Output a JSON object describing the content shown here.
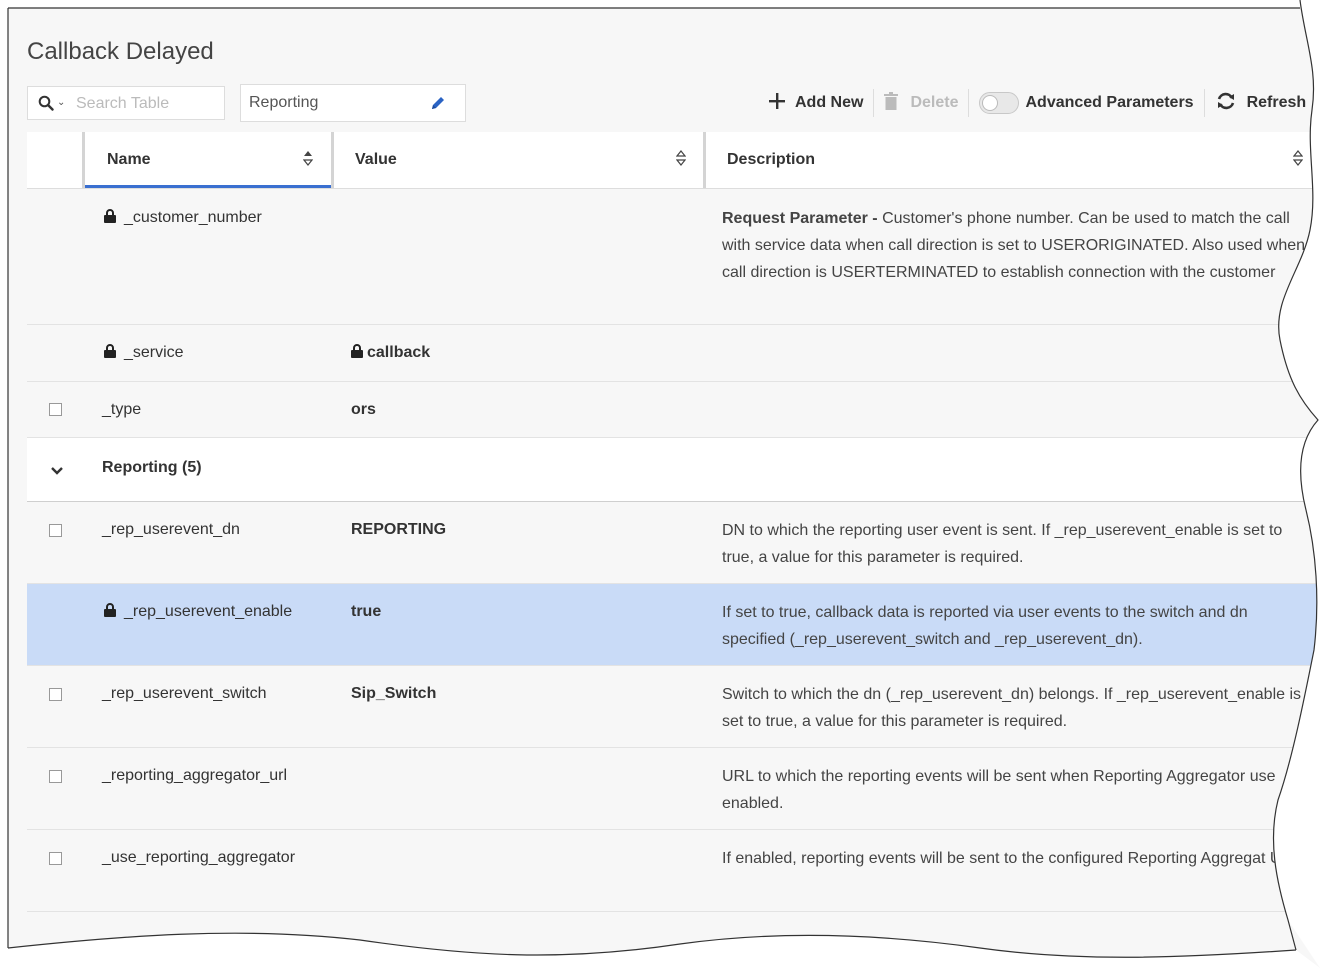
{
  "page": {
    "title": "Callback Delayed"
  },
  "toolbar": {
    "search_placeholder": "Search Table",
    "group_value": "Reporting",
    "add_label": "Add New",
    "delete_label": "Delete",
    "advanced_label": "Advanced Parameters",
    "refresh_label": "Refresh"
  },
  "columns": {
    "name": "Name",
    "value": "Value",
    "description": "Description"
  },
  "rows": {
    "customer_number": {
      "name": "_customer_number",
      "value": "",
      "desc_lead": "Request Parameter -",
      "desc": "Customer's phone number. Can be used to match the call with service data when call direction is set to USERORIGINATED. Also used when call direction is USERTERMINATED to establish connection with the customer"
    },
    "service": {
      "name": "_service",
      "value": "callback"
    },
    "type": {
      "name": "_type",
      "value": "ors"
    },
    "group": {
      "label": "Reporting (5)"
    },
    "rep_dn": {
      "name": "_rep_userevent_dn",
      "value": "REPORTING",
      "desc": "DN to which the reporting user event is sent. If _rep_userevent_enable is set to true, a value for this parameter is required."
    },
    "rep_enable": {
      "name": "_rep_userevent_enable",
      "value": "true",
      "desc": "If set to true, callback data is reported via user events to the switch and dn specified (_rep_userevent_switch and _rep_userevent_dn)."
    },
    "rep_switch": {
      "name": "_rep_userevent_switch",
      "value": "Sip_Switch",
      "desc": "Switch to which the dn (_rep_userevent_dn) belongs. If _rep_userevent_enable is set to true, a value for this parameter is required."
    },
    "agg_url": {
      "name": "_reporting_aggregator_url",
      "value": "",
      "desc": "URL to which the reporting events will be sent when Reporting Aggregator use enabled."
    },
    "use_agg": {
      "name": "_use_reporting_aggregator",
      "value": "",
      "desc": "If enabled, reporting events will be sent to the configured Reporting Aggregat URL."
    }
  },
  "colors": {
    "selected_row": "#c9dbf7",
    "sort_underline": "#3a6fd0",
    "edit_icon": "#2a63c4"
  }
}
